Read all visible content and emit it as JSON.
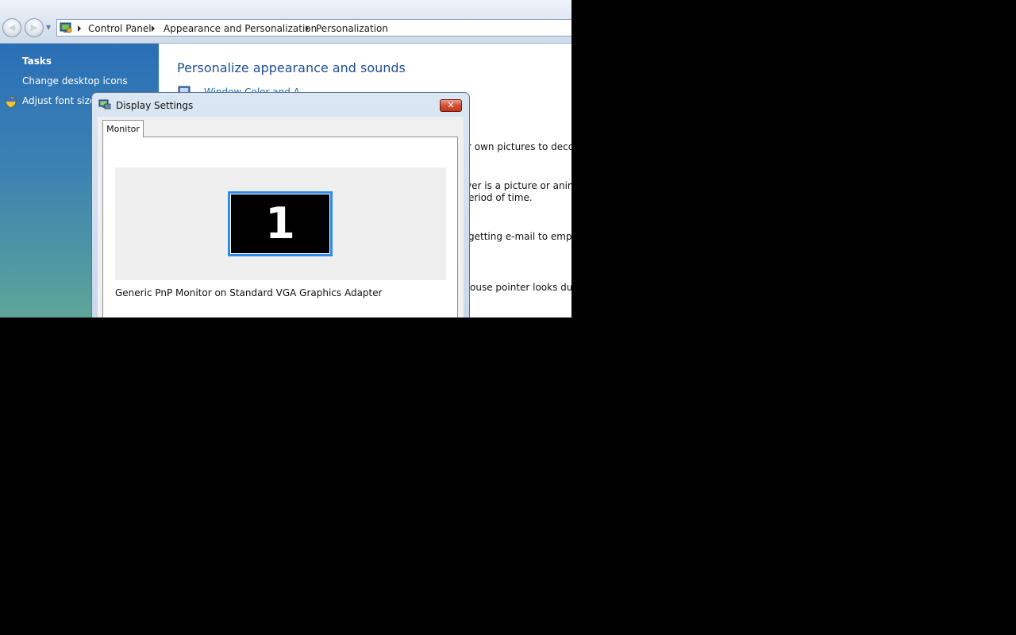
{
  "address_bar": {
    "back_icon": "back-arrow-icon",
    "forward_icon": "forward-arrow-icon",
    "breadcrumbs": [
      {
        "label": "Control Panel"
      },
      {
        "label": "Appearance and Personalization"
      },
      {
        "label": "Personalization"
      }
    ]
  },
  "task_pane": {
    "heading": "Tasks",
    "links": [
      {
        "label": "Change desktop icons"
      },
      {
        "label": "Adjust font size (",
        "icon": "shield-icon"
      }
    ]
  },
  "main": {
    "title": "Personalize appearance and sounds",
    "items": [
      {
        "link": "Window Color and A"
      },
      {
        "desc": "r own pictures to decorat"
      },
      {
        "desc_line1": "ver is a picture or animat",
        "desc_line2": "eriod of time."
      },
      {
        "desc": "getting e-mail to emptyin"
      },
      {
        "desc": "ouse pointer looks during"
      }
    ]
  },
  "dialog": {
    "title": "Display Settings",
    "close_icon": "close-icon",
    "tabs": [
      {
        "label": "Monitor"
      }
    ],
    "monitor_number": "1",
    "monitor_name": "Generic PnP Monitor on Standard VGA Graphics Adapter"
  },
  "colors": {
    "title_blue": "#1e4d96",
    "link_blue": "#1f6fc0",
    "monitor_border": "#2f8ce6",
    "close_red": "#c0391f"
  }
}
